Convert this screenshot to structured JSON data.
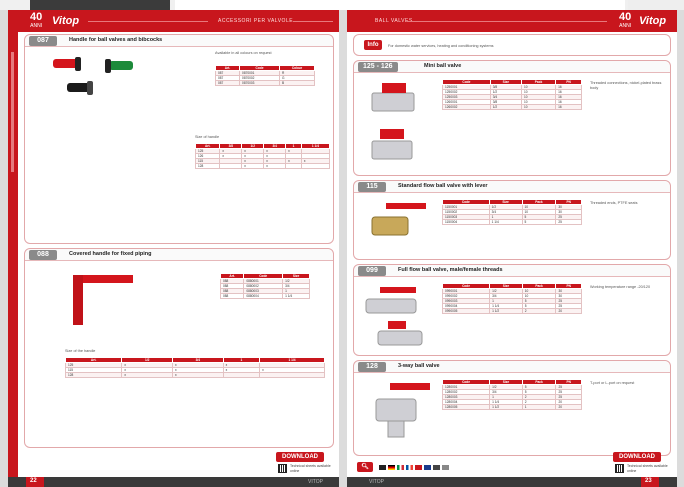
{
  "header": {
    "left_logo_num": "40",
    "left_logo_sub": "ANNI",
    "left_brand": "Vitop",
    "left_title": "ACCESSORI PER VALVOLE",
    "right_title": "BALL VALVES",
    "right_logo_num": "40",
    "right_logo_sub": "ANNI",
    "right_brand": "Vitop"
  },
  "left_page": {
    "section1": {
      "code": "087",
      "title": "Handle for ball valves and bibcocks",
      "note": "Available in all colours on request",
      "table_headers": [
        "Art.",
        "Code",
        "Colour"
      ],
      "table_rows": [
        [
          "087",
          "0870001",
          "R"
        ],
        [
          "087",
          "0870002",
          "G"
        ],
        [
          "087",
          "0870003",
          "B"
        ]
      ],
      "table2_note": "Size of handle",
      "table2_headers": [
        "Art.",
        "3/8",
        "1/2",
        "3/4",
        "1",
        "1 1/4"
      ],
      "table2_rows": [
        [
          "125",
          "x",
          "x",
          "x",
          "x",
          ""
        ],
        [
          "126",
          "x",
          "x",
          "x",
          "",
          ""
        ],
        [
          "115",
          "",
          "x",
          "x",
          "x",
          "x"
        ],
        [
          "128",
          "",
          "x",
          "x",
          "",
          ""
        ]
      ]
    },
    "section2": {
      "code": "088",
      "title": "Covered handle for fixed piping",
      "table_headers": [
        "Art.",
        "Code",
        "Size"
      ],
      "table_rows": [
        [
          "088",
          "0880001",
          "1/2"
        ],
        [
          "088",
          "0880002",
          "3/4"
        ],
        [
          "088",
          "0880003",
          "1"
        ],
        [
          "088",
          "0880004",
          "1 1/4"
        ]
      ],
      "table2_note": "Size of the handle",
      "table2_headers": [
        "Art.",
        "1/2",
        "3/4",
        "1",
        "1 1/4"
      ],
      "table2_rows": [
        [
          "125",
          "x",
          "x",
          "x",
          ""
        ],
        [
          "115",
          "x",
          "x",
          "x",
          "x"
        ],
        [
          "128",
          "x",
          "x",
          "",
          ""
        ]
      ]
    },
    "download": {
      "label": "DOWNLOAD",
      "note": "Technical sheets available online"
    },
    "footer": {
      "page_number": "22",
      "mid_text": "VITOP"
    }
  },
  "right_page": {
    "info": {
      "badge": "Info",
      "text": "For domestic water services, heating and conditioning systems"
    },
    "sections": [
      {
        "code": "125 - 126",
        "title": "Mini ball valve",
        "note": "Threaded connections, nickel-plated brass body",
        "table_headers": [
          "Code",
          "Size",
          "Pack",
          "PN"
        ],
        "table_rows": [
          [
            "1250001",
            "3/8",
            "10",
            "16"
          ],
          [
            "1250002",
            "1/2",
            "10",
            "16"
          ],
          [
            "1250003",
            "3/4",
            "10",
            "16"
          ],
          [
            "1260001",
            "3/8",
            "10",
            "16"
          ],
          [
            "1260002",
            "1/2",
            "10",
            "16"
          ]
        ]
      },
      {
        "code": "115",
        "title": "Standard flow ball valve with lever",
        "note": "Threaded ends, PTFE seats",
        "table_headers": [
          "Code",
          "Size",
          "Pack",
          "PN"
        ],
        "table_rows": [
          [
            "1150001",
            "1/2",
            "10",
            "30"
          ],
          [
            "1150002",
            "3/4",
            "10",
            "30"
          ],
          [
            "1150003",
            "1",
            "5",
            "25"
          ],
          [
            "1150004",
            "1 1/4",
            "5",
            "25"
          ]
        ]
      },
      {
        "code": "099",
        "title": "Full flow ball valve, male/female threads",
        "note": "Working temperature range -20/120",
        "table_headers": [
          "Code",
          "Size",
          "Pack",
          "PN"
        ],
        "table_rows": [
          [
            "0990001",
            "1/2",
            "10",
            "30"
          ],
          [
            "0990002",
            "3/4",
            "10",
            "30"
          ],
          [
            "0990003",
            "1",
            "5",
            "25"
          ],
          [
            "0990004",
            "1 1/4",
            "5",
            "25"
          ],
          [
            "0990005",
            "1 1/2",
            "2",
            "20"
          ]
        ]
      },
      {
        "code": "128",
        "title": "3-way ball valve",
        "note": "T-port or L-port on request",
        "table_headers": [
          "Code",
          "Size",
          "Pack",
          "PN"
        ],
        "table_rows": [
          [
            "1280001",
            "1/2",
            "5",
            "25"
          ],
          [
            "1280002",
            "3/4",
            "5",
            "25"
          ],
          [
            "1280003",
            "1",
            "2",
            "25"
          ],
          [
            "1280004",
            "1 1/4",
            "2",
            "20"
          ],
          [
            "1280005",
            "1 1/2",
            "1",
            "20"
          ]
        ]
      }
    ],
    "download": {
      "label": "DOWNLOAD",
      "note": "Technical sheets available online"
    },
    "footer": {
      "page_number": "23",
      "mid_text": "VITOP"
    }
  }
}
